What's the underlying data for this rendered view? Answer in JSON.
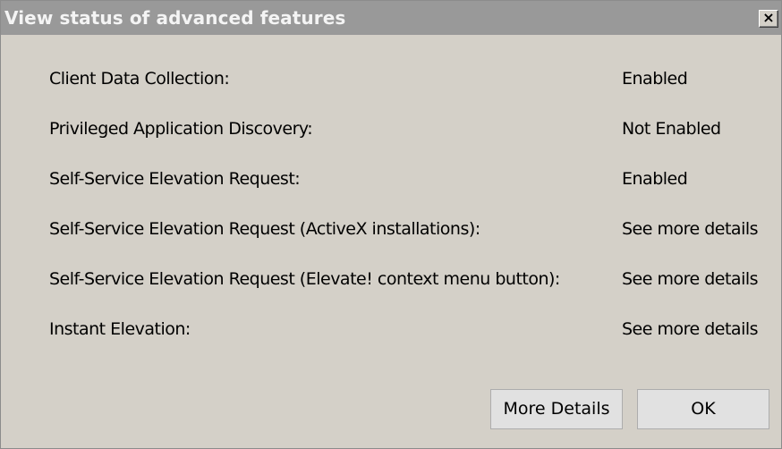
{
  "window": {
    "title": "View status of advanced features",
    "close_label": "×"
  },
  "features": [
    {
      "label": "Client Data Collection:",
      "value": "Enabled"
    },
    {
      "label": "Privileged Application Discovery:",
      "value": "Not Enabled"
    },
    {
      "label": "Self-Service Elevation Request:",
      "value": "Enabled"
    },
    {
      "label": "Self-Service Elevation Request (ActiveX installations):",
      "value": "See more details"
    },
    {
      "label": "Self-Service Elevation Request (Elevate! context menu button):",
      "value": "See more details"
    },
    {
      "label": "Instant Elevation:",
      "value": "See more details"
    }
  ],
  "buttons": {
    "more_details": "More Details",
    "ok": "OK"
  }
}
